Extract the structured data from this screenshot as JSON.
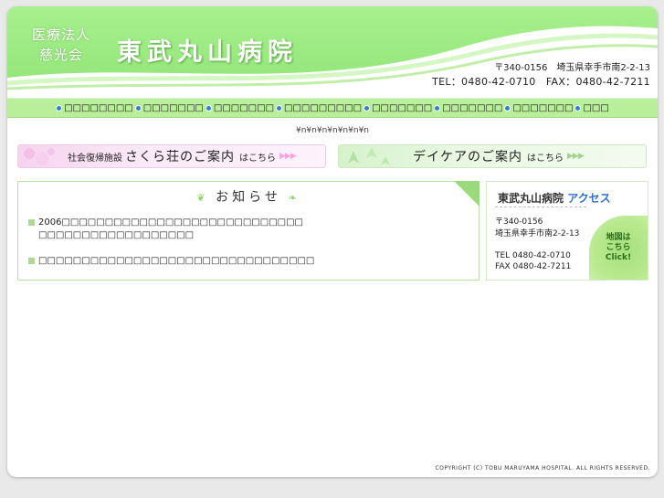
{
  "header": {
    "corp_line1": "医療法人",
    "corp_line2": "慈光会",
    "hospital_name": "東武丸山病院",
    "address": "〒340-0156　埼玉県幸手市南2-2-13",
    "tel_fax": "TEL：0480-42-0710　FAX：0480-42-7211"
  },
  "nav": {
    "items": [
      "□□□□□□□□",
      "□□□□□□□",
      "□□□□□□□",
      "□□□□□□□□□",
      "□□□□□□□",
      "□□□□□□□",
      "□□□□□□□",
      "□□□"
    ]
  },
  "encoding_text": "¥n¥n¥n¥n¥n¥n¥n",
  "banners": {
    "sakura": {
      "small": "社会復帰施設",
      "big": "さくら荘のご案内",
      "suffix": "はこちら",
      "arrows": "▶▶▶"
    },
    "daycare": {
      "big": "デイケアのご案内",
      "suffix": "はこちら",
      "arrows": "▶▶▶"
    }
  },
  "news": {
    "title": "お知らせ",
    "items": [
      {
        "line1": "2006□□□□□□□□□□□□□□□□□□□□□□□□□□□□",
        "line2": "□□□□□□□□□□□□□□□□□□"
      },
      {
        "line1": "□□□□□□□□□□□□□□□□□□□□□□□□□□□□□□□□"
      }
    ]
  },
  "access": {
    "title": "東武丸山病院",
    "link": "アクセス",
    "postal": "〒340-0156",
    "street": "埼玉県幸手市南2-2-13",
    "tel": "TEL 0480-42-0710",
    "fax": "FAX 0480-42-7211",
    "map_line1": "地図は",
    "map_line2": "こちら",
    "map_line3": "Click!"
  },
  "footer": {
    "copyright": "COPYRIGHT (C) TOBU MARUYAMA HOSPITAL. ALL RIGHTS RESERVED."
  },
  "colors": {
    "header_green": "#a8f08e",
    "nav_green": "#b9ee9b",
    "nav_dot_blue": "#2f7fd1",
    "access_link_blue": "#2f6fd1"
  }
}
